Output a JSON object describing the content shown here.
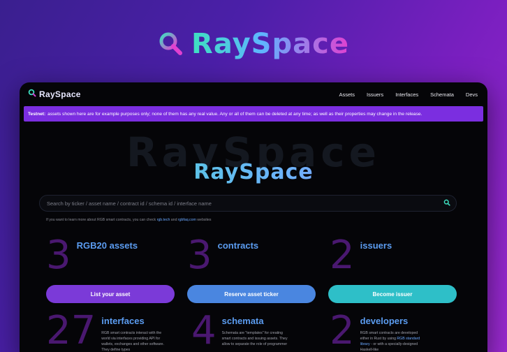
{
  "hero": {
    "brand": "RaySpace"
  },
  "nav": {
    "brand": "RaySpace",
    "links": [
      "Assets",
      "Issuers",
      "Interfaces",
      "Schemata",
      "Devs"
    ]
  },
  "banner": {
    "strong": "Testnet:",
    "text": "assets shown here are for example purposes only; none of them has any real value. Any or all of them can be deleted at any time; as well as their properties may change in the release."
  },
  "main": {
    "ghost": "RaySpace",
    "logo": "RaySpace",
    "search_placeholder": "Search by ticker / asset name / contract id / schema id / interface name",
    "hint_pre": "If you want to learn more about RGB smart contracts, you can check",
    "hint_link1": "rgb.tech",
    "hint_and": "and",
    "hint_link2": "rgbfaq.com",
    "hint_post": "websites"
  },
  "stats": {
    "assets": {
      "num": "3",
      "label": "RGB20 assets"
    },
    "contracts": {
      "num": "3",
      "label": "contracts"
    },
    "issuers": {
      "num": "2",
      "label": "issuers"
    },
    "interfaces": {
      "num": "27",
      "label": "interfaces",
      "desc": "RGB smart contracts interact with the world via interfaces providing API for wallets, exchanges and other software. They define types"
    },
    "schemata": {
      "num": "4",
      "label": "schemata",
      "desc": "Schemata are \"templates\" for creating smart contracts and issuing assets. They allow to separate the role of programmer"
    },
    "developers": {
      "num": "2",
      "label": "developers",
      "desc_pre": "RGB smart contracts are developed either in Rust by using",
      "desc_link": "RGB standard library",
      "desc_post": "- or with a specially-designed Haskell-like"
    }
  },
  "buttons": {
    "list": "List your asset",
    "reserve": "Reserve asset ticker",
    "become": "Become issuer"
  },
  "colors": {
    "list_btn": "#7b3ad8",
    "reserve_btn": "#4a86e0",
    "become_btn": "#2ebfc8",
    "banner": "#7b2ee0"
  }
}
